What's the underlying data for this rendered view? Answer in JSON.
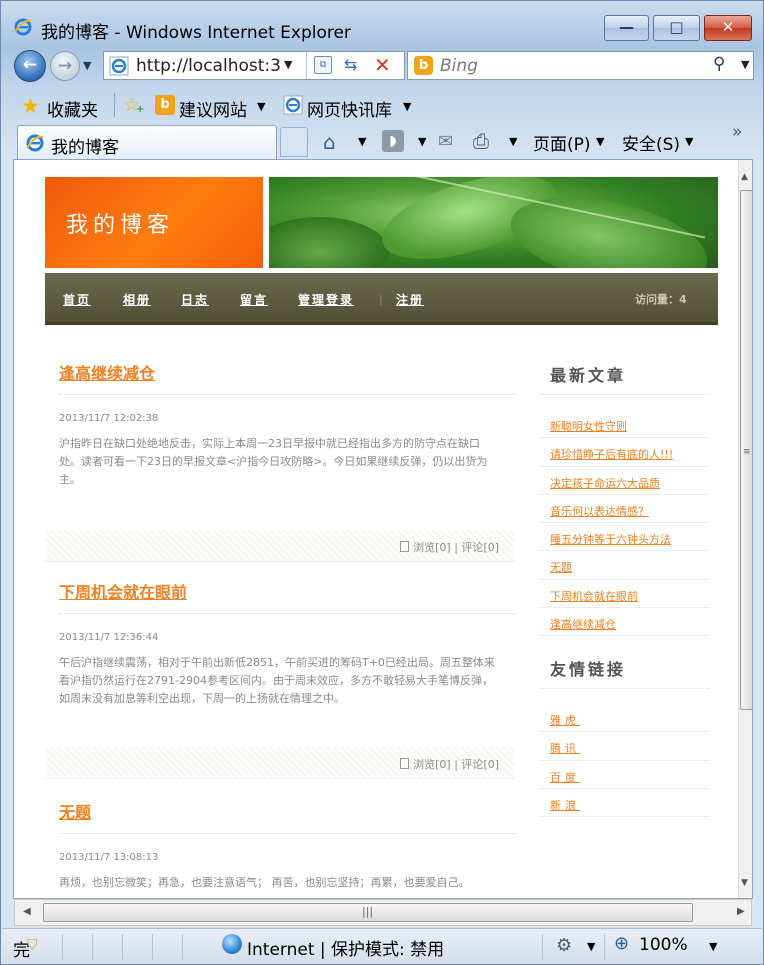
{
  "window": {
    "title": "我的博客 - Windows Internet Explorer"
  },
  "toolbar": {
    "address": "http://localhost:3",
    "search_placeholder": "Bing"
  },
  "favorites": {
    "label": "收藏夹",
    "suggested": "建议网站",
    "webslice": "网页快讯库"
  },
  "tab": {
    "label": "我的博客"
  },
  "commands": {
    "page": "页面(P)",
    "safety": "安全(S)"
  },
  "blog": {
    "title": "我的博客",
    "nav": [
      "首页",
      "相册",
      "日志",
      "留言",
      "管理登录",
      "注册"
    ],
    "visits": "访问量：4",
    "posts": [
      {
        "title": "逢高继续减仓",
        "date": "2013/11/7 12:02:38",
        "body": "沪指昨日在缺口处绝地反击，实际上本周一23日早报中就已经指出多方的防守点在缺口处。读者可看一下23日的早报文章<沪指今日攻防略>。今日如果继续反弹，仍以出货为主。",
        "meta": "浏览[0] | 评论[0]"
      },
      {
        "title": "下周机会就在眼前",
        "date": "2013/11/7 12:36:44",
        "body": "午后沪指继续震荡，相对于午前出新低2851，午前买进的筹码T+0已经出局。周五整体来看沪指仍然运行在2791-2904参考区间内。由于周末效应，多方不敢轻易大手笔博反弹，如周末没有加息等利空出现，下周一的上扬就在情理之中。",
        "meta": "浏览[0] | 评论[0]"
      },
      {
        "title": "无题",
        "date": "2013/11/7 13:08:13",
        "body": "再烦，也别忘微笑；再急，也要注意语气；  再苦，也别忘坚持；再累，也要爱自己。",
        "meta": ""
      }
    ],
    "latest_heading": "最新文章",
    "latest": [
      "新聪明女性守则",
      "请珍惜睁子后有底的人!!!",
      "决定孩子命运六大品质",
      "音乐何以表达情感？",
      "睡五分钟等于六钟头方法",
      "无题",
      "下周机会就在眼前",
      "逢高继续减仓"
    ],
    "links_heading": "友情链接",
    "links": [
      "雅虎",
      "腾讯",
      "百度",
      "新浪"
    ]
  },
  "status": {
    "done": "完",
    "zone": "Internet | 保护模式: 禁用",
    "zoom": "100%"
  }
}
